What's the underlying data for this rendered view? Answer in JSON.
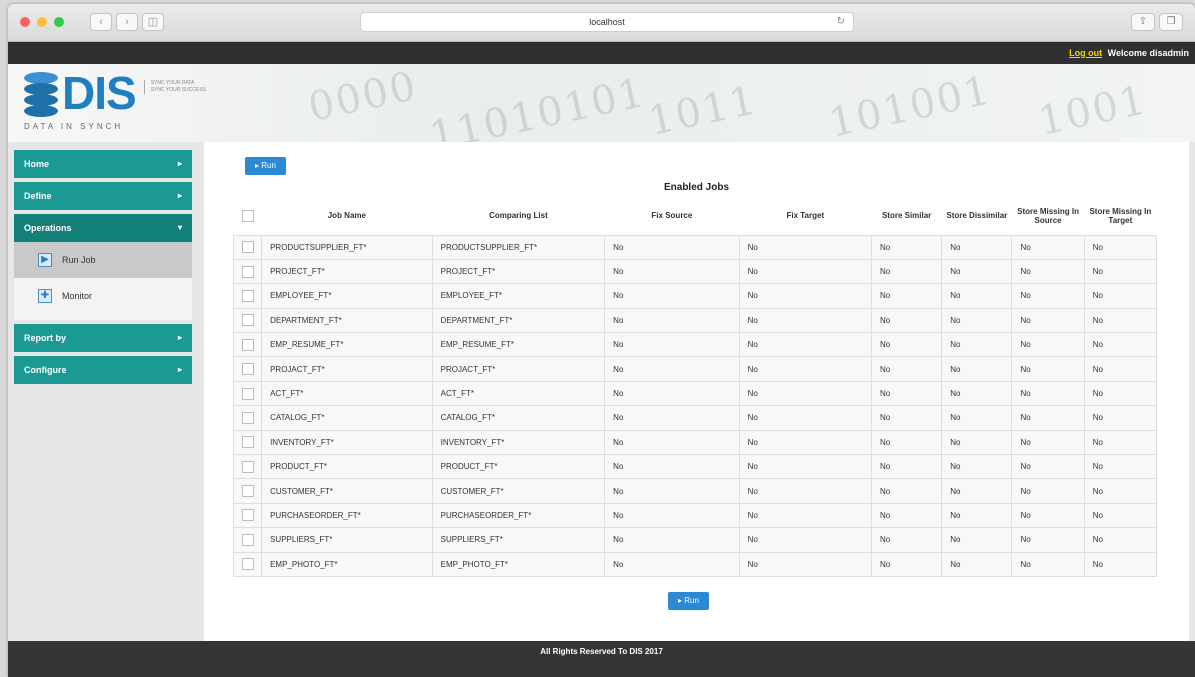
{
  "browser": {
    "url": "localhost"
  },
  "header": {
    "logout_label": "Log out",
    "welcome_text": "Welcome disadmin"
  },
  "logo": {
    "name": "DIS",
    "subtitle": "DATA IN SYNCH",
    "tagline_1": "SYNC YOUR DATA",
    "tagline_2": "SYNC YOUR SUCCESS"
  },
  "sidebar": {
    "items": [
      {
        "label": "Home"
      },
      {
        "label": "Define"
      },
      {
        "label": "Operations"
      },
      {
        "label": "Report by"
      },
      {
        "label": "Configure"
      }
    ],
    "sub_items": [
      {
        "label": "Run Job",
        "icon": "run-job-icon"
      },
      {
        "label": "Monitor",
        "icon": "monitor-icon"
      }
    ]
  },
  "main": {
    "run_label": "Run",
    "table_title": "Enabled Jobs",
    "columns": [
      "Job Name",
      "Comparing List",
      "Fix Source",
      "Fix Target",
      "Store Similar",
      "Store Dissimilar",
      "Store Missing In Source",
      "Store Missing In Target"
    ],
    "rows": [
      [
        "PRODUCTSUPPLIER_FT*",
        "PRODUCTSUPPLIER_FT*",
        "No",
        "No",
        "No",
        "No",
        "No",
        "No"
      ],
      [
        "PROJECT_FT*",
        "PROJECT_FT*",
        "No",
        "No",
        "No",
        "No",
        "No",
        "No"
      ],
      [
        "EMPLOYEE_FT*",
        "EMPLOYEE_FT*",
        "No",
        "No",
        "No",
        "No",
        "No",
        "No"
      ],
      [
        "DEPARTMENT_FT*",
        "DEPARTMENT_FT*",
        "No",
        "No",
        "No",
        "No",
        "No",
        "No"
      ],
      [
        "EMP_RESUME_FT*",
        "EMP_RESUME_FT*",
        "No",
        "No",
        "No",
        "No",
        "No",
        "No"
      ],
      [
        "PROJACT_FT*",
        "PROJACT_FT*",
        "No",
        "No",
        "No",
        "No",
        "No",
        "No"
      ],
      [
        "ACT_FT*",
        "ACT_FT*",
        "No",
        "No",
        "No",
        "No",
        "No",
        "No"
      ],
      [
        "CATALOG_FT*",
        "CATALOG_FT*",
        "No",
        "No",
        "No",
        "No",
        "No",
        "No"
      ],
      [
        "INVENTORY_FT*",
        "INVENTORY_FT*",
        "No",
        "No",
        "No",
        "No",
        "No",
        "No"
      ],
      [
        "PRODUCT_FT*",
        "PRODUCT_FT*",
        "No",
        "No",
        "No",
        "No",
        "No",
        "No"
      ],
      [
        "CUSTOMER_FT*",
        "CUSTOMER_FT*",
        "No",
        "No",
        "No",
        "No",
        "No",
        "No"
      ],
      [
        "PURCHASEORDER_FT*",
        "PURCHASEORDER_FT*",
        "No",
        "No",
        "No",
        "No",
        "No",
        "No"
      ],
      [
        "SUPPLIERS_FT*",
        "SUPPLIERS_FT*",
        "No",
        "No",
        "No",
        "No",
        "No",
        "No"
      ],
      [
        "EMP_PHOTO_FT*",
        "EMP_PHOTO_FT*",
        "No",
        "No",
        "No",
        "No",
        "No",
        "No"
      ]
    ]
  },
  "footer": {
    "text": "All Rights Reserved To DIS 2017"
  },
  "colors": {
    "accent": "#1a9a93",
    "run_button": "#2a8ad4",
    "logo": "#1f7fc0"
  }
}
